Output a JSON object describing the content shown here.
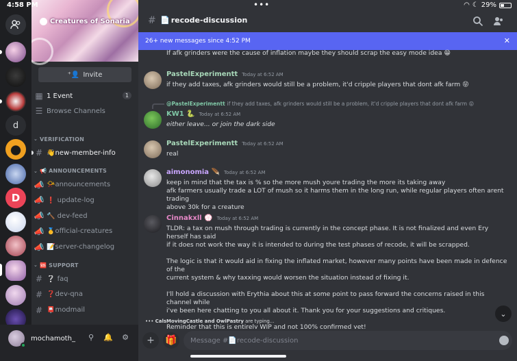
{
  "status_bar": {
    "time": "4:58 PM",
    "dots": "•••",
    "battery_pct_label": "29%",
    "battery_level": 0.29
  },
  "server": {
    "name": "Creatures of Sonaria",
    "invite_label": "Invite",
    "events_label": "1 Event",
    "events_count": "1",
    "browse_label": "Browse Channels"
  },
  "categories": [
    {
      "name": "VERIFICATION",
      "channels": [
        {
          "name": "👋new-member-info",
          "bright": true
        }
      ]
    },
    {
      "name": "📢 ANNOUNCEMENTS",
      "channels": [
        {
          "name": "📯announcements",
          "bright": false
        },
        {
          "name": "❗ update-log",
          "bright": false
        },
        {
          "name": "🔨 dev-feed",
          "bright": false
        },
        {
          "name": "🥇official-creatures",
          "bright": false
        },
        {
          "name": "📝server-changelog",
          "bright": false
        }
      ]
    },
    {
      "name": "🆘 SUPPORT",
      "channels": [
        {
          "name": "❔ faq",
          "bright": false
        },
        {
          "name": "❓dev-qna",
          "bright": false
        },
        {
          "name": "📮modmail",
          "bright": false
        }
      ]
    }
  ],
  "user": {
    "name": "mochamoth_"
  },
  "channel": {
    "name": "recode-discussion",
    "placeholder": "Message #📄recode-discussion"
  },
  "banner_new": {
    "text": "26+ new messages since 4:52 PM"
  },
  "messages": [
    {
      "author": "",
      "time": "",
      "lines": [
        "If afk grinders were the cause of inflation maybe they should scrap the easy mode idea 😁"
      ]
    },
    {
      "author": "PastelExperimentt",
      "color": "#a8d8b9",
      "time": "Today at 6:52 AM",
      "lines": [
        "if they add taxes, afk grinders would still be a problem, it'd cripple players that dont afk farm 😝"
      ]
    },
    {
      "author": "KW1 🐍",
      "color": "#80c7a6",
      "time": "Today at 6:52 AM",
      "reply": {
        "name": "@PastelExperimentt",
        "text": "if they add taxes, afk grinders would still be a problem, it'd cripple players that dont afk farm 😝"
      },
      "lines": [
        "either leave... or join the dark side"
      ]
    },
    {
      "author": "PastelExperimentt",
      "color": "#a8d8b9",
      "time": "Today at 6:52 AM",
      "lines": [
        "real"
      ]
    },
    {
      "author": "aimonomia 🪶",
      "color": "#c9a6ff",
      "time": "Today at 6:52 AM",
      "lines": [
        "keep in mind that the tax is % so the more mush youre trading the more its taking away",
        "afk farmers usually trade a LOT of mush so it harms them in the long run, while regular players often arent trading",
        "above 30k for a creature"
      ]
    },
    {
      "author": "Cinnakxll 💮",
      "color": "#e889c9",
      "time": "Today at 6:52 AM",
      "lines": [
        "TLDR: a tax on mush through trading is currently in the concept phase. It is not finalized and even Ery herself has said",
        "if it does not work the way it is intended to during the test phases of recode, it will be scrapped.",
        "",
        "The logic is that it would aid in fixing the inflated market, however many points have been made in defence of the",
        "current system & why taxxing would worsen the situation instead of fixing it.",
        "",
        "I'll hold a discussion with Erythia about this at some point to pass forward the concerns raised in this channel while",
        "i've been here chatting to you all about it. Thank you for your suggestions and critiques.",
        "",
        "Reminder that this is entirely WIP and not 100% confirmed yet!"
      ]
    }
  ],
  "typing": {
    "names": "CalsMovingCastle and OwlPastry",
    "suffix": " are typing..."
  }
}
